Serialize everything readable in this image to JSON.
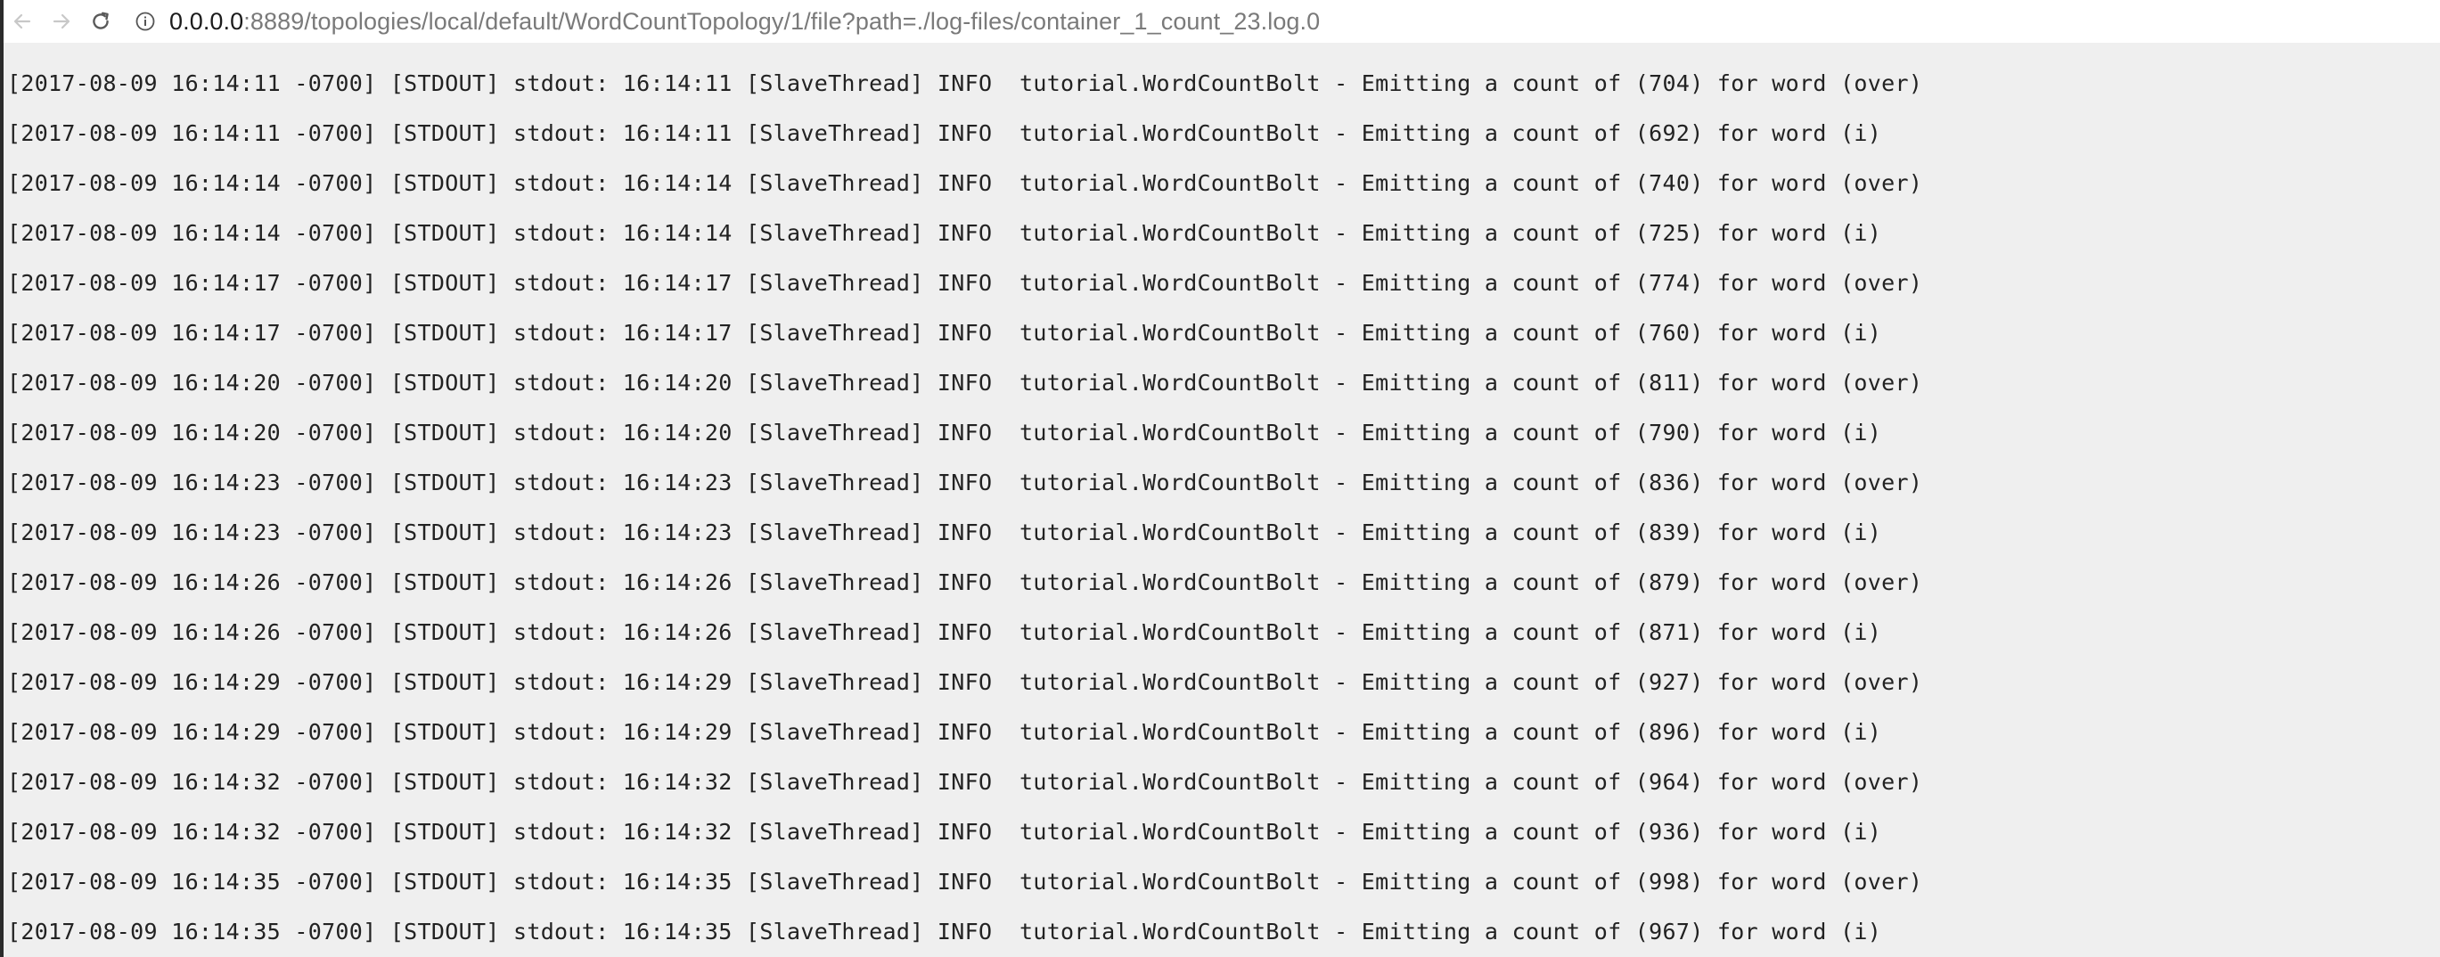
{
  "browser": {
    "url_host": "0.0.0.0",
    "url_rest": ":8889/topologies/local/default/WordCountTopology/1/file?path=./log-files/container_1_count_23.log.0"
  },
  "log": {
    "lines": [
      "[2017-08-09 16:14:11 -0700] [STDOUT] stdout: 16:14:11 [SlaveThread] INFO  tutorial.WordCountBolt - Emitting a count of (704) for word (over)",
      "[2017-08-09 16:14:11 -0700] [STDOUT] stdout: 16:14:11 [SlaveThread] INFO  tutorial.WordCountBolt - Emitting a count of (692) for word (i)",
      "[2017-08-09 16:14:14 -0700] [STDOUT] stdout: 16:14:14 [SlaveThread] INFO  tutorial.WordCountBolt - Emitting a count of (740) for word (over)",
      "[2017-08-09 16:14:14 -0700] [STDOUT] stdout: 16:14:14 [SlaveThread] INFO  tutorial.WordCountBolt - Emitting a count of (725) for word (i)",
      "[2017-08-09 16:14:17 -0700] [STDOUT] stdout: 16:14:17 [SlaveThread] INFO  tutorial.WordCountBolt - Emitting a count of (774) for word (over)",
      "[2017-08-09 16:14:17 -0700] [STDOUT] stdout: 16:14:17 [SlaveThread] INFO  tutorial.WordCountBolt - Emitting a count of (760) for word (i)",
      "[2017-08-09 16:14:20 -0700] [STDOUT] stdout: 16:14:20 [SlaveThread] INFO  tutorial.WordCountBolt - Emitting a count of (811) for word (over)",
      "[2017-08-09 16:14:20 -0700] [STDOUT] stdout: 16:14:20 [SlaveThread] INFO  tutorial.WordCountBolt - Emitting a count of (790) for word (i)",
      "[2017-08-09 16:14:23 -0700] [STDOUT] stdout: 16:14:23 [SlaveThread] INFO  tutorial.WordCountBolt - Emitting a count of (836) for word (over)",
      "[2017-08-09 16:14:23 -0700] [STDOUT] stdout: 16:14:23 [SlaveThread] INFO  tutorial.WordCountBolt - Emitting a count of (839) for word (i)",
      "[2017-08-09 16:14:26 -0700] [STDOUT] stdout: 16:14:26 [SlaveThread] INFO  tutorial.WordCountBolt - Emitting a count of (879) for word (over)",
      "[2017-08-09 16:14:26 -0700] [STDOUT] stdout: 16:14:26 [SlaveThread] INFO  tutorial.WordCountBolt - Emitting a count of (871) for word (i)",
      "[2017-08-09 16:14:29 -0700] [STDOUT] stdout: 16:14:29 [SlaveThread] INFO  tutorial.WordCountBolt - Emitting a count of (927) for word (over)",
      "[2017-08-09 16:14:29 -0700] [STDOUT] stdout: 16:14:29 [SlaveThread] INFO  tutorial.WordCountBolt - Emitting a count of (896) for word (i)",
      "[2017-08-09 16:14:32 -0700] [STDOUT] stdout: 16:14:32 [SlaveThread] INFO  tutorial.WordCountBolt - Emitting a count of (964) for word (over)",
      "[2017-08-09 16:14:32 -0700] [STDOUT] stdout: 16:14:32 [SlaveThread] INFO  tutorial.WordCountBolt - Emitting a count of (936) for word (i)",
      "[2017-08-09 16:14:35 -0700] [STDOUT] stdout: 16:14:35 [SlaveThread] INFO  tutorial.WordCountBolt - Emitting a count of (998) for word (over)",
      "[2017-08-09 16:14:35 -0700] [STDOUT] stdout: 16:14:35 [SlaveThread] INFO  tutorial.WordCountBolt - Emitting a count of (967) for word (i)"
    ]
  }
}
